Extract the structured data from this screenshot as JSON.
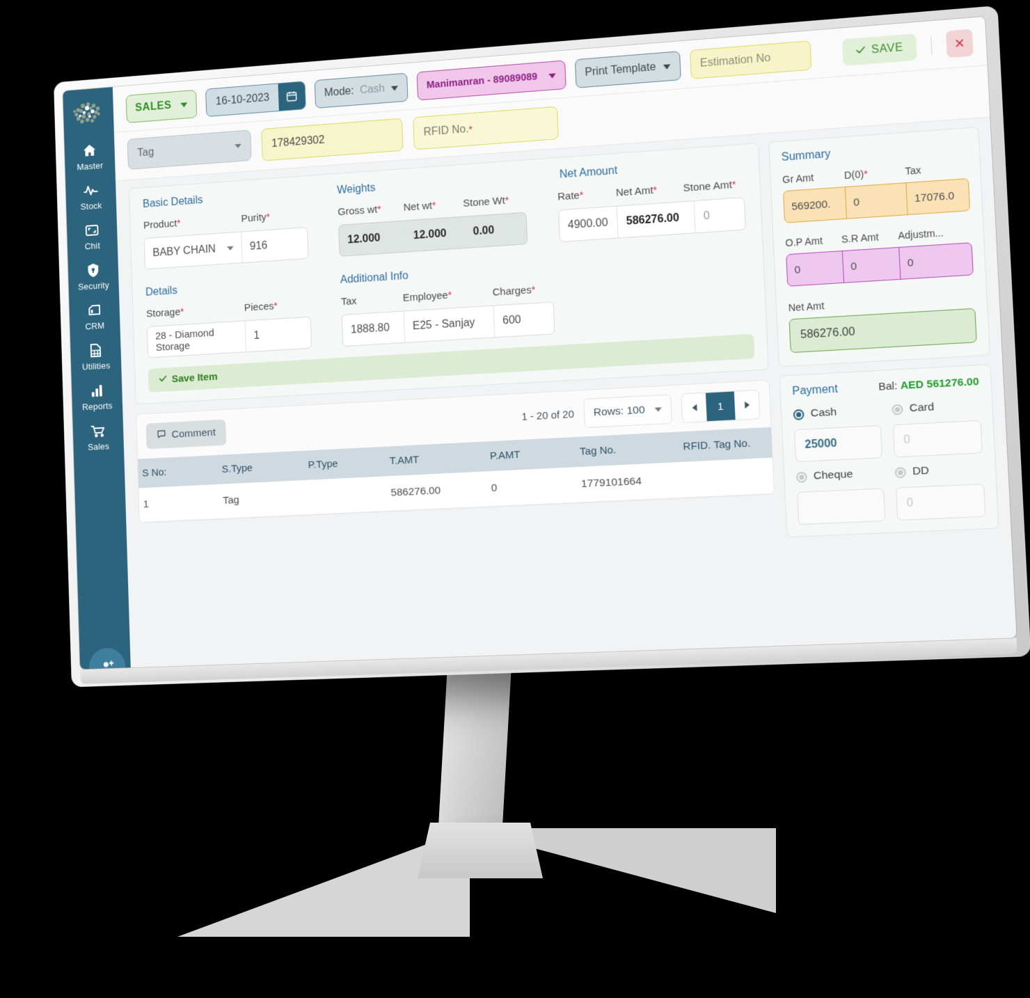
{
  "sidebar": {
    "logo_icon": "dot-cluster-logo",
    "items": [
      {
        "label": "Master",
        "icon": "home-icon"
      },
      {
        "label": "Stock",
        "icon": "pulse-icon"
      },
      {
        "label": "Chit",
        "icon": "chit-icon"
      },
      {
        "label": "Security",
        "icon": "shield-icon"
      },
      {
        "label": "CRM",
        "icon": "crm-icon"
      },
      {
        "label": "Utilities",
        "icon": "grid-page-icon"
      },
      {
        "label": "Reports",
        "icon": "bar-chart-icon"
      },
      {
        "label": "Sales",
        "icon": "cart-icon"
      }
    ],
    "fab_icon": "add-user-icon"
  },
  "toolbar": {
    "type_label": "SALES",
    "date_value": "16-10-2023",
    "calendar_icon": "calendar-icon",
    "mode_label": "Mode:",
    "mode_value": "Cash",
    "customer": "Manimanran - 89089089",
    "print_template": "Print Template",
    "estimation_placeholder": "Estimation No",
    "save_label": "SAVE",
    "close_label": "✕"
  },
  "tagrow": {
    "type_value": "Tag",
    "tag_number": "178429302",
    "rfid_placeholder": "RFID No.",
    "rfid_required": "*"
  },
  "item": {
    "basic_title": "Basic Details",
    "weights_title": "Weights",
    "netamount_title": "Net Amount",
    "details_title": "Details",
    "additional_title": "Additional Info",
    "labels": {
      "product": "Product",
      "purity": "Purity",
      "gross_wt": "Gross wt",
      "net_wt": "Net wt",
      "stone_wt": "Stone Wt",
      "rate": "Rate",
      "net_amt": "Net Amt",
      "stone_amt": "Stone Amt",
      "storage": "Storage",
      "pieces": "Pieces",
      "tax": "Tax",
      "employee": "Employee",
      "charges": "Charges"
    },
    "values": {
      "product": "BABY CHAIN",
      "purity": "916",
      "gross_wt": "12.000",
      "net_wt": "12.000",
      "stone_wt": "0.00",
      "rate": "4900.00",
      "net_amt": "586276.00",
      "stone_amt": "0",
      "storage": "28 - Diamond Storage",
      "pieces": "1",
      "tax": "1888.80",
      "employee": "E25 - Sanjay",
      "charges": "600"
    },
    "save_item_label": "Save Item"
  },
  "summary": {
    "title": "Summary",
    "labels": {
      "gr_amt": "Gr Amt",
      "discount": "D(0)",
      "tax": "Tax",
      "op_amt": "O.P Amt",
      "sr_amt": "S.R Amt",
      "adjustment": "Adjustm...",
      "net_amt": "Net Amt"
    },
    "values": {
      "gr_amt": "569200.",
      "discount": "0",
      "tax": "17076.0",
      "op_amt": "0",
      "sr_amt": "0",
      "adjustment": "0",
      "net_amt": "586276.00"
    },
    "colors": {
      "amber": "#fbe2b6",
      "violet": "#eec8ef",
      "green": "#dcecd3"
    }
  },
  "payment": {
    "title": "Payment",
    "balance_label": "Bal:",
    "balance_value": "AED 561276.00",
    "options": [
      {
        "label": "Cash",
        "value": "25000",
        "selected": true
      },
      {
        "label": "Card",
        "value": "0",
        "selected": false
      },
      {
        "label": "Cheque",
        "value": "",
        "selected": false
      },
      {
        "label": "DD",
        "value": "0",
        "selected": false
      }
    ]
  },
  "table": {
    "comment_label": "Comment",
    "comment_icon": "comment-icon",
    "range_text": "1 - 20 of 20",
    "rows_label": "Rows: 100",
    "prev_icon": "chevron-left-icon",
    "next_icon": "chevron-right-icon",
    "current_page": "1",
    "columns": [
      "S No:",
      "S.Type",
      "P.Type",
      "T.AMT",
      "P.AMT",
      "Tag No.",
      "RFID. Tag No."
    ],
    "rows": [
      [
        "1",
        "Tag",
        "",
        "586276.00",
        "0",
        "1779101664",
        ""
      ]
    ]
  }
}
